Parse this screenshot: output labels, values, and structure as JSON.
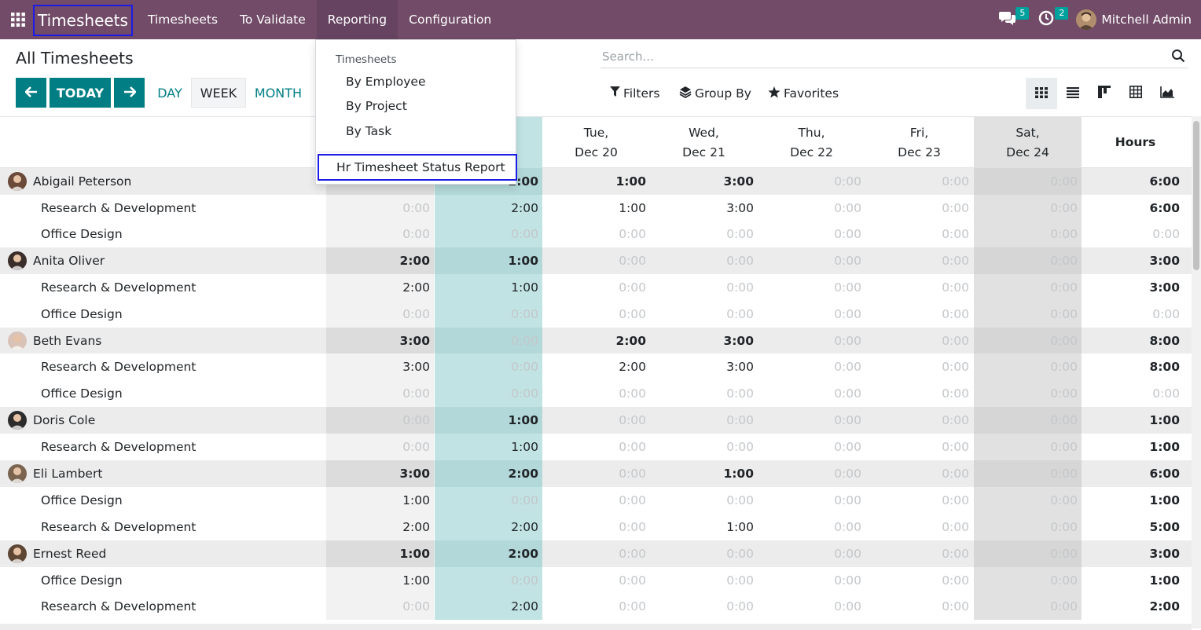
{
  "navbar": {
    "app_name": "Timesheets",
    "menu": [
      "Timesheets",
      "To Validate",
      "Reporting",
      "Configuration"
    ],
    "messages_count": "5",
    "activities_count": "2",
    "user_name": "Mitchell Admin"
  },
  "control": {
    "title": "All Timesheets",
    "today_label": "TODAY",
    "ranges": [
      "DAY",
      "WEEK",
      "MONTH"
    ],
    "search_placeholder": "Search...",
    "filters_label": "Filters",
    "group_by_label": "Group By",
    "favorites_label": "Favorites"
  },
  "dropdown": {
    "header": "Timesheets",
    "items": [
      "By Employee",
      "By Project",
      "By Task"
    ],
    "report_item": "Hr Timesheet Status Report"
  },
  "grid": {
    "columns": [
      {
        "day": "Tue,",
        "date": "Dec 20"
      },
      {
        "day": "Wed,",
        "date": "Dec 21"
      },
      {
        "day": "Thu,",
        "date": "Dec 22"
      },
      {
        "day": "Fri,",
        "date": "Dec 23"
      },
      {
        "day": "Sat,",
        "date": "Dec 24"
      }
    ],
    "total_header": "Hours",
    "rows": [
      {
        "type": "emp",
        "name": "Abigail Peterson",
        "values": [
          "",
          "2:00",
          "1:00",
          "3:00",
          "0:00",
          "0:00",
          "0:00"
        ],
        "total": "6:00"
      },
      {
        "type": "proj",
        "name": "Research & Development",
        "values": [
          "0:00",
          "2:00",
          "1:00",
          "3:00",
          "0:00",
          "0:00",
          "0:00"
        ],
        "total": "6:00"
      },
      {
        "type": "proj",
        "name": "Office Design",
        "values": [
          "0:00",
          "0:00",
          "0:00",
          "0:00",
          "0:00",
          "0:00",
          "0:00"
        ],
        "total": "0:00"
      },
      {
        "type": "emp",
        "name": "Anita Oliver",
        "values": [
          "2:00",
          "1:00",
          "0:00",
          "0:00",
          "0:00",
          "0:00",
          "0:00"
        ],
        "total": "3:00"
      },
      {
        "type": "proj",
        "name": "Research & Development",
        "values": [
          "2:00",
          "1:00",
          "0:00",
          "0:00",
          "0:00",
          "0:00",
          "0:00"
        ],
        "total": "3:00"
      },
      {
        "type": "proj",
        "name": "Office Design",
        "values": [
          "0:00",
          "0:00",
          "0:00",
          "0:00",
          "0:00",
          "0:00",
          "0:00"
        ],
        "total": "0:00"
      },
      {
        "type": "emp",
        "name": "Beth Evans",
        "values": [
          "3:00",
          "0:00",
          "2:00",
          "3:00",
          "0:00",
          "0:00",
          "0:00"
        ],
        "total": "8:00"
      },
      {
        "type": "proj",
        "name": "Research & Development",
        "values": [
          "3:00",
          "0:00",
          "2:00",
          "3:00",
          "0:00",
          "0:00",
          "0:00"
        ],
        "total": "8:00"
      },
      {
        "type": "proj",
        "name": "Office Design",
        "values": [
          "0:00",
          "0:00",
          "0:00",
          "0:00",
          "0:00",
          "0:00",
          "0:00"
        ],
        "total": "0:00"
      },
      {
        "type": "emp",
        "name": "Doris Cole",
        "values": [
          "0:00",
          "1:00",
          "0:00",
          "0:00",
          "0:00",
          "0:00",
          "0:00"
        ],
        "total": "1:00"
      },
      {
        "type": "proj",
        "name": "Research & Development",
        "values": [
          "0:00",
          "1:00",
          "0:00",
          "0:00",
          "0:00",
          "0:00",
          "0:00"
        ],
        "total": "1:00"
      },
      {
        "type": "emp",
        "name": "Eli Lambert",
        "values": [
          "3:00",
          "2:00",
          "0:00",
          "1:00",
          "0:00",
          "0:00",
          "0:00"
        ],
        "total": "6:00"
      },
      {
        "type": "proj",
        "name": "Office Design",
        "values": [
          "1:00",
          "0:00",
          "0:00",
          "0:00",
          "0:00",
          "0:00",
          "0:00"
        ],
        "total": "1:00"
      },
      {
        "type": "proj",
        "name": "Research & Development",
        "values": [
          "2:00",
          "2:00",
          "0:00",
          "1:00",
          "0:00",
          "0:00",
          "0:00"
        ],
        "total": "5:00"
      },
      {
        "type": "emp",
        "name": "Ernest Reed",
        "values": [
          "1:00",
          "2:00",
          "0:00",
          "0:00",
          "0:00",
          "0:00",
          "0:00"
        ],
        "total": "3:00"
      },
      {
        "type": "proj",
        "name": "Office Design",
        "values": [
          "1:00",
          "0:00",
          "0:00",
          "0:00",
          "0:00",
          "0:00",
          "0:00"
        ],
        "total": "1:00"
      },
      {
        "type": "proj",
        "name": "Research & Development",
        "values": [
          "0:00",
          "2:00",
          "0:00",
          "0:00",
          "0:00",
          "0:00",
          "0:00"
        ],
        "total": "2:00"
      }
    ]
  },
  "colors": {
    "navbar": "#714b67",
    "primary": "#017e84",
    "today_column": "#c1e3e3",
    "weekend_column": "#e1e1e1",
    "highlight_border": "#1c1ce6"
  }
}
